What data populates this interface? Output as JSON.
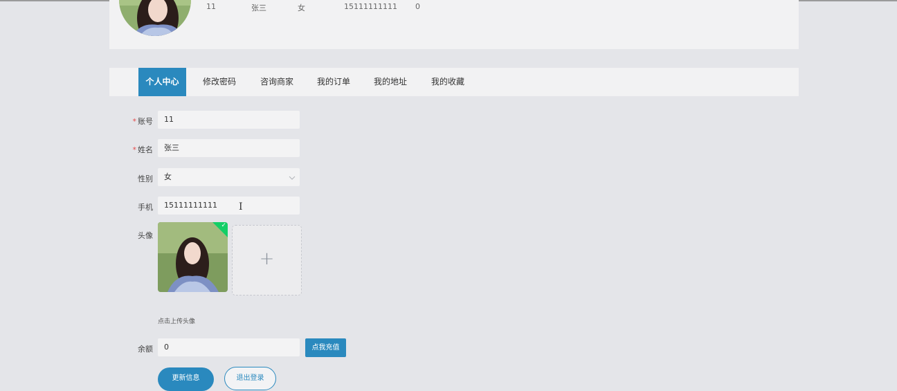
{
  "profile": {
    "account": "11",
    "name": "张三",
    "gender": "女",
    "phone": "15111111111",
    "balance": "0"
  },
  "tabs": [
    "个人中心",
    "修改密码",
    "咨询商家",
    "我的订单",
    "我的地址",
    "我的收藏"
  ],
  "form": {
    "account_label": "账号",
    "account_value": "11",
    "name_label": "姓名",
    "name_value": "张三",
    "gender_label": "性别",
    "gender_value": "女",
    "phone_label": "手机",
    "phone_value": "15111111111",
    "avatar_label": "头像",
    "upload_tip": "点击上传头像",
    "balance_label": "余额",
    "balance_value": "0",
    "required_mark": "*",
    "plus_icon": "+",
    "check_icon": "✓",
    "cursor_icon": "I"
  },
  "buttons": {
    "recharge": "点我充值",
    "update": "更新信息",
    "logout": "退出登录"
  },
  "colors": {
    "accent": "#2a89be",
    "background": "#e4e5e9",
    "card": "#f2f2f3",
    "required": "#e54a4a",
    "success": "#13ce66"
  }
}
